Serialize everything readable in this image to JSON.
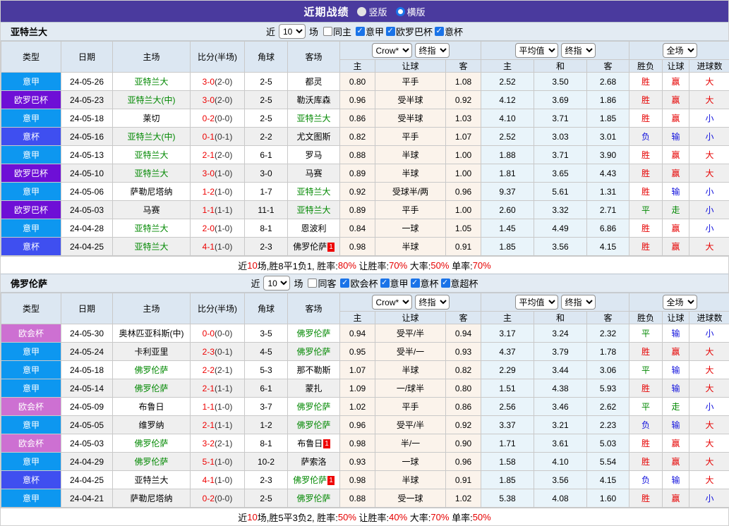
{
  "titlebar": {
    "title": "近期战绩",
    "radios": [
      {
        "label": "竖版",
        "checked": false
      },
      {
        "label": "横版",
        "checked": true
      }
    ]
  },
  "table_header": {
    "type": "类型",
    "date": "日期",
    "home": "主场",
    "score": "比分(半场)",
    "corner": "角球",
    "away": "客场",
    "asian_cols": [
      "主",
      "让球",
      "客"
    ],
    "euro_cols": [
      "主",
      "和",
      "客"
    ],
    "result_cols": [
      "胜负",
      "让球",
      "进球数"
    ],
    "selects": {
      "bookmaker": "Crow*",
      "final1": "终指",
      "average": "平均值",
      "final2": "终指",
      "scope": "全场"
    }
  },
  "league_colors": {
    "意甲": "#0d97f0",
    "欧罗巴杯": "#6e0fd6",
    "意杯": "#3f4ff0",
    "欧会杯": "#cd70d2"
  },
  "text_colors": {
    "r": "#e60000",
    "b": "#1212dd",
    "g": "#008800",
    "k": "#000000"
  },
  "sections": [
    {
      "team": "亚特兰大",
      "filter": {
        "near": "近",
        "count": "10",
        "games": "场",
        "same": "同主",
        "same_checked": false,
        "leagues": [
          "意甲",
          "欧罗巴杯",
          "意杯"
        ]
      },
      "rows": [
        {
          "league": "意甲",
          "date": "24-05-26",
          "home": "亚特兰大",
          "home_green": true,
          "score": "3-0",
          "half": "(2-0)",
          "corner": "2-5",
          "away": "都灵",
          "odds": [
            "0.80",
            "平手",
            "1.08",
            "2.52",
            "3.50",
            "2.68"
          ],
          "results": [
            [
              "胜",
              "r"
            ],
            [
              "赢",
              "r"
            ],
            [
              "大",
              "r"
            ]
          ]
        },
        {
          "league": "欧罗巴杯",
          "date": "24-05-23",
          "home": "亚特兰大(中)",
          "home_green": true,
          "score": "3-0",
          "half": "(2-0)",
          "corner": "2-5",
          "away": "勒沃库森",
          "odds": [
            "0.96",
            "受半球",
            "0.92",
            "4.12",
            "3.69",
            "1.86"
          ],
          "results": [
            [
              "胜",
              "r"
            ],
            [
              "赢",
              "r"
            ],
            [
              "大",
              "r"
            ]
          ]
        },
        {
          "league": "意甲",
          "date": "24-05-18",
          "home": "莱切",
          "score": "0-2",
          "half": "(0-0)",
          "corner": "2-5",
          "away": "亚特兰大",
          "away_green": true,
          "odds": [
            "0.86",
            "受半球",
            "1.03",
            "4.10",
            "3.71",
            "1.85"
          ],
          "results": [
            [
              "胜",
              "r"
            ],
            [
              "赢",
              "r"
            ],
            [
              "小",
              "b"
            ]
          ]
        },
        {
          "league": "意杯",
          "date": "24-05-16",
          "home": "亚特兰大(中)",
          "home_green": true,
          "score": "0-1",
          "half": "(0-1)",
          "corner": "2-2",
          "away": "尤文图斯",
          "odds": [
            "0.82",
            "平手",
            "1.07",
            "2.52",
            "3.03",
            "3.01"
          ],
          "results": [
            [
              "负",
              "b"
            ],
            [
              "输",
              "b"
            ],
            [
              "小",
              "b"
            ]
          ]
        },
        {
          "league": "意甲",
          "date": "24-05-13",
          "home": "亚特兰大",
          "home_green": true,
          "score": "2-1",
          "half": "(2-0)",
          "corner": "6-1",
          "away": "罗马",
          "odds": [
            "0.88",
            "半球",
            "1.00",
            "1.88",
            "3.71",
            "3.90"
          ],
          "results": [
            [
              "胜",
              "r"
            ],
            [
              "赢",
              "r"
            ],
            [
              "大",
              "r"
            ]
          ]
        },
        {
          "league": "欧罗巴杯",
          "date": "24-05-10",
          "home": "亚特兰大",
          "home_green": true,
          "score": "3-0",
          "half": "(1-0)",
          "corner": "3-0",
          "away": "马赛",
          "odds": [
            "0.89",
            "半球",
            "1.00",
            "1.81",
            "3.65",
            "4.43"
          ],
          "results": [
            [
              "胜",
              "r"
            ],
            [
              "赢",
              "r"
            ],
            [
              "大",
              "r"
            ]
          ]
        },
        {
          "league": "意甲",
          "date": "24-05-06",
          "home": "萨勒尼塔纳",
          "score": "1-2",
          "half": "(1-0)",
          "corner": "1-7",
          "away": "亚特兰大",
          "away_green": true,
          "odds": [
            "0.92",
            "受球半/两",
            "0.96",
            "9.37",
            "5.61",
            "1.31"
          ],
          "results": [
            [
              "胜",
              "r"
            ],
            [
              "输",
              "b"
            ],
            [
              "小",
              "b"
            ]
          ]
        },
        {
          "league": "欧罗巴杯",
          "date": "24-05-03",
          "home": "马赛",
          "score": "1-1",
          "half": "(1-1)",
          "corner": "11-1",
          "away": "亚特兰大",
          "away_green": true,
          "odds": [
            "0.89",
            "平手",
            "1.00",
            "2.60",
            "3.32",
            "2.71"
          ],
          "results": [
            [
              "平",
              "g"
            ],
            [
              "走",
              "g"
            ],
            [
              "小",
              "b"
            ]
          ]
        },
        {
          "league": "意甲",
          "date": "24-04-28",
          "home": "亚特兰大",
          "home_green": true,
          "score": "2-0",
          "half": "(1-0)",
          "corner": "8-1",
          "away": "恩波利",
          "odds": [
            "0.84",
            "一球",
            "1.05",
            "1.45",
            "4.49",
            "6.86"
          ],
          "results": [
            [
              "胜",
              "r"
            ],
            [
              "赢",
              "r"
            ],
            [
              "小",
              "b"
            ]
          ]
        },
        {
          "league": "意杯",
          "date": "24-04-25",
          "home": "亚特兰大",
          "home_green": true,
          "score": "4-1",
          "half": "(1-0)",
          "corner": "2-3",
          "away": "佛罗伦萨",
          "away_badge": "1",
          "odds": [
            "0.98",
            "半球",
            "0.91",
            "1.85",
            "3.56",
            "4.15"
          ],
          "results": [
            [
              "胜",
              "r"
            ],
            [
              "赢",
              "r"
            ],
            [
              "大",
              "r"
            ]
          ]
        }
      ],
      "summary": [
        [
          "近",
          "k"
        ],
        [
          "10",
          "r"
        ],
        [
          "场,胜8平1负1, 胜率:",
          "k"
        ],
        [
          "80%",
          "r"
        ],
        [
          " 让胜率:",
          "k"
        ],
        [
          "70%",
          "r"
        ],
        [
          " 大率:",
          "k"
        ],
        [
          "50%",
          "r"
        ],
        [
          " 单率:",
          "k"
        ],
        [
          "70%",
          "r"
        ]
      ]
    },
    {
      "team": "佛罗伦萨",
      "filter": {
        "near": "近",
        "count": "10",
        "games": "场",
        "same": "同客",
        "same_checked": false,
        "leagues": [
          "欧会杯",
          "意甲",
          "意杯",
          "意超杯"
        ]
      },
      "rows": [
        {
          "league": "欧会杯",
          "date": "24-05-30",
          "home": "奥林匹亚科斯(中)",
          "score": "0-0",
          "half": "(0-0)",
          "corner": "3-5",
          "away": "佛罗伦萨",
          "away_green": true,
          "odds": [
            "0.94",
            "受平/半",
            "0.94",
            "3.17",
            "3.24",
            "2.32"
          ],
          "results": [
            [
              "平",
              "g"
            ],
            [
              "输",
              "b"
            ],
            [
              "小",
              "b"
            ]
          ]
        },
        {
          "league": "意甲",
          "date": "24-05-24",
          "home": "卡利亚里",
          "score": "2-3",
          "half": "(0-1)",
          "corner": "4-5",
          "away": "佛罗伦萨",
          "away_green": true,
          "odds": [
            "0.95",
            "受半/一",
            "0.93",
            "4.37",
            "3.79",
            "1.78"
          ],
          "results": [
            [
              "胜",
              "r"
            ],
            [
              "赢",
              "r"
            ],
            [
              "大",
              "r"
            ]
          ]
        },
        {
          "league": "意甲",
          "date": "24-05-18",
          "home": "佛罗伦萨",
          "home_green": true,
          "score": "2-2",
          "half": "(2-1)",
          "corner": "5-3",
          "away": "那不勒斯",
          "odds": [
            "1.07",
            "半球",
            "0.82",
            "2.29",
            "3.44",
            "3.06"
          ],
          "results": [
            [
              "平",
              "g"
            ],
            [
              "输",
              "b"
            ],
            [
              "大",
              "r"
            ]
          ]
        },
        {
          "league": "意甲",
          "date": "24-05-14",
          "home": "佛罗伦萨",
          "home_green": true,
          "score": "2-1",
          "half": "(1-1)",
          "corner": "6-1",
          "away": "蒙扎",
          "odds": [
            "1.09",
            "一/球半",
            "0.80",
            "1.51",
            "4.38",
            "5.93"
          ],
          "results": [
            [
              "胜",
              "r"
            ],
            [
              "输",
              "b"
            ],
            [
              "大",
              "r"
            ]
          ]
        },
        {
          "league": "欧会杯",
          "date": "24-05-09",
          "home": "布鲁日",
          "score": "1-1",
          "half": "(1-0)",
          "corner": "3-7",
          "away": "佛罗伦萨",
          "away_green": true,
          "odds": [
            "1.02",
            "平手",
            "0.86",
            "2.56",
            "3.46",
            "2.62"
          ],
          "results": [
            [
              "平",
              "g"
            ],
            [
              "走",
              "g"
            ],
            [
              "小",
              "b"
            ]
          ]
        },
        {
          "league": "意甲",
          "date": "24-05-05",
          "home": "维罗纳",
          "score": "2-1",
          "half": "(1-1)",
          "corner": "1-2",
          "away": "佛罗伦萨",
          "away_green": true,
          "odds": [
            "0.96",
            "受平/半",
            "0.92",
            "3.37",
            "3.21",
            "2.23"
          ],
          "results": [
            [
              "负",
              "b"
            ],
            [
              "输",
              "b"
            ],
            [
              "大",
              "r"
            ]
          ]
        },
        {
          "league": "欧会杯",
          "date": "24-05-03",
          "home": "佛罗伦萨",
          "home_green": true,
          "score": "3-2",
          "half": "(2-1)",
          "corner": "8-1",
          "away": "布鲁日",
          "away_badge": "1",
          "odds": [
            "0.98",
            "半/一",
            "0.90",
            "1.71",
            "3.61",
            "5.03"
          ],
          "results": [
            [
              "胜",
              "r"
            ],
            [
              "赢",
              "r"
            ],
            [
              "大",
              "r"
            ]
          ]
        },
        {
          "league": "意甲",
          "date": "24-04-29",
          "home": "佛罗伦萨",
          "home_green": true,
          "score": "5-1",
          "half": "(1-0)",
          "corner": "10-2",
          "away": "萨索洛",
          "odds": [
            "0.93",
            "一球",
            "0.96",
            "1.58",
            "4.10",
            "5.54"
          ],
          "results": [
            [
              "胜",
              "r"
            ],
            [
              "赢",
              "r"
            ],
            [
              "大",
              "r"
            ]
          ]
        },
        {
          "league": "意杯",
          "date": "24-04-25",
          "home": "亚特兰大",
          "score": "4-1",
          "half": "(1-0)",
          "corner": "2-3",
          "away": "佛罗伦萨",
          "away_green": true,
          "away_badge": "1",
          "odds": [
            "0.98",
            "半球",
            "0.91",
            "1.85",
            "3.56",
            "4.15"
          ],
          "results": [
            [
              "负",
              "b"
            ],
            [
              "输",
              "b"
            ],
            [
              "大",
              "r"
            ]
          ]
        },
        {
          "league": "意甲",
          "date": "24-04-21",
          "home": "萨勒尼塔纳",
          "score": "0-2",
          "half": "(0-0)",
          "corner": "2-5",
          "away": "佛罗伦萨",
          "away_green": true,
          "odds": [
            "0.88",
            "受一球",
            "1.02",
            "5.38",
            "4.08",
            "1.60"
          ],
          "results": [
            [
              "胜",
              "r"
            ],
            [
              "赢",
              "r"
            ],
            [
              "小",
              "b"
            ]
          ]
        }
      ],
      "summary": [
        [
          "近",
          "k"
        ],
        [
          "10",
          "r"
        ],
        [
          "场,胜5平3负2, 胜率:",
          "k"
        ],
        [
          "50%",
          "r"
        ],
        [
          " 让胜率:",
          "k"
        ],
        [
          "40%",
          "r"
        ],
        [
          " 大率:",
          "k"
        ],
        [
          "70%",
          "r"
        ],
        [
          " 单率:",
          "k"
        ],
        [
          "50%",
          "r"
        ]
      ]
    }
  ]
}
